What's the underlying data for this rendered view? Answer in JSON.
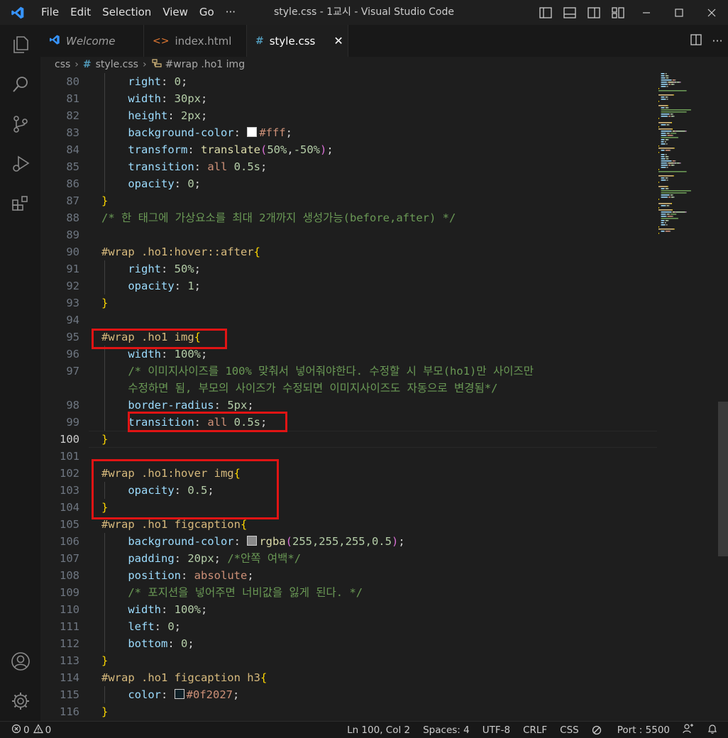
{
  "window": {
    "title": "style.css - 1교시 - Visual Studio Code",
    "menu": [
      "File",
      "Edit",
      "Selection",
      "View",
      "Go",
      "···"
    ]
  },
  "tabs": [
    {
      "label": "Welcome",
      "icon": "vscode-logo-icon",
      "icon_color": "#3794ff"
    },
    {
      "label": "index.html",
      "icon": "html-icon",
      "icon_color": "#e37933"
    },
    {
      "label": "style.css",
      "icon": "css-hash-icon",
      "icon_color": "#519aba",
      "active": true
    }
  ],
  "breadcrumb": {
    "folder": "css",
    "file": "style.css",
    "symbol": "#wrap .ho1 img"
  },
  "editor": {
    "current_line": 100,
    "lines": [
      {
        "n": "80",
        "tokens": [
          [
            "    ",
            "txt"
          ],
          [
            "right",
            "prop"
          ],
          [
            ": ",
            "txt"
          ],
          [
            "0",
            "num"
          ],
          [
            ";",
            "txt"
          ]
        ]
      },
      {
        "n": "81",
        "tokens": [
          [
            "    ",
            "txt"
          ],
          [
            "width",
            "prop"
          ],
          [
            ": ",
            "txt"
          ],
          [
            "30px",
            "num"
          ],
          [
            ";",
            "txt"
          ]
        ]
      },
      {
        "n": "82",
        "tokens": [
          [
            "    ",
            "txt"
          ],
          [
            "height",
            "prop"
          ],
          [
            ": ",
            "txt"
          ],
          [
            "2px",
            "num"
          ],
          [
            ";",
            "txt"
          ]
        ]
      },
      {
        "n": "83",
        "tokens": [
          [
            "    ",
            "txt"
          ],
          [
            "background-color",
            "prop"
          ],
          [
            ": ",
            "txt"
          ],
          [
            "#ffffff",
            "swatch"
          ],
          [
            "#fff",
            "kw"
          ],
          [
            ";",
            "txt"
          ]
        ]
      },
      {
        "n": "84",
        "tokens": [
          [
            "    ",
            "txt"
          ],
          [
            "transform",
            "prop"
          ],
          [
            ": ",
            "txt"
          ],
          [
            "translate",
            "fn"
          ],
          [
            "(",
            "br2"
          ],
          [
            "50%",
            "num"
          ],
          [
            ",",
            "txt"
          ],
          [
            "-50%",
            "num"
          ],
          [
            ")",
            "br2"
          ],
          [
            ";",
            "txt"
          ]
        ]
      },
      {
        "n": "85",
        "tokens": [
          [
            "    ",
            "txt"
          ],
          [
            "transition",
            "prop"
          ],
          [
            ": ",
            "txt"
          ],
          [
            "all ",
            "kw"
          ],
          [
            "0.5s",
            "num"
          ],
          [
            ";",
            "txt"
          ]
        ]
      },
      {
        "n": "86",
        "tokens": [
          [
            "    ",
            "txt"
          ],
          [
            "opacity",
            "prop"
          ],
          [
            ": ",
            "txt"
          ],
          [
            "0",
            "num"
          ],
          [
            ";",
            "txt"
          ]
        ]
      },
      {
        "n": "87",
        "tokens": [
          [
            "}",
            "br1"
          ]
        ]
      },
      {
        "n": "88",
        "tokens": [
          [
            "/* 한 태그에 가상요소를 최대 2개까지 생성가능(before,after) */",
            "cm"
          ]
        ]
      },
      {
        "n": "89",
        "tokens": []
      },
      {
        "n": "90",
        "tokens": [
          [
            "#wrap .ho1:hover::after",
            "sel"
          ],
          [
            "{",
            "br1"
          ]
        ]
      },
      {
        "n": "91",
        "tokens": [
          [
            "    ",
            "txt"
          ],
          [
            "right",
            "prop"
          ],
          [
            ": ",
            "txt"
          ],
          [
            "50%",
            "num"
          ],
          [
            ";",
            "txt"
          ]
        ]
      },
      {
        "n": "92",
        "tokens": [
          [
            "    ",
            "txt"
          ],
          [
            "opacity",
            "prop"
          ],
          [
            ": ",
            "txt"
          ],
          [
            "1",
            "num"
          ],
          [
            ";",
            "txt"
          ]
        ]
      },
      {
        "n": "93",
        "tokens": [
          [
            "}",
            "br1"
          ]
        ]
      },
      {
        "n": "94",
        "tokens": []
      },
      {
        "n": "95",
        "tokens": [
          [
            "#wrap .ho1 img",
            "sel"
          ],
          [
            "{",
            "br1"
          ]
        ]
      },
      {
        "n": "96",
        "tokens": [
          [
            "    ",
            "txt"
          ],
          [
            "width",
            "prop"
          ],
          [
            ": ",
            "txt"
          ],
          [
            "100%",
            "num"
          ],
          [
            ";",
            "txt"
          ]
        ]
      },
      {
        "n": "97",
        "tokens": [
          [
            "    ",
            "txt"
          ],
          [
            "/* 이미지사이즈를 100% 맞춰서 넣어줘야한다. 수정할 시 부모(ho1)만 사이즈만",
            "cm"
          ]
        ]
      },
      {
        "n": "",
        "tokens": [
          [
            "    ",
            "txt"
          ],
          [
            "수정하면 됨, 부모의 사이즈가 수정되면 이미지사이즈도 자동으로 변경됨*/",
            "cm"
          ]
        ]
      },
      {
        "n": "98",
        "tokens": [
          [
            "    ",
            "txt"
          ],
          [
            "border-radius",
            "prop"
          ],
          [
            ": ",
            "txt"
          ],
          [
            "5px",
            "num"
          ],
          [
            ";",
            "txt"
          ]
        ]
      },
      {
        "n": "99",
        "tokens": [
          [
            "    ",
            "txt"
          ],
          [
            "transition",
            "prop"
          ],
          [
            ": ",
            "txt"
          ],
          [
            "all ",
            "kw"
          ],
          [
            "0.5s",
            "num"
          ],
          [
            ";",
            "txt"
          ]
        ]
      },
      {
        "n": "100",
        "tokens": [
          [
            "}",
            "br1"
          ]
        ]
      },
      {
        "n": "101",
        "tokens": []
      },
      {
        "n": "102",
        "tokens": [
          [
            "#wrap .ho1:hover img",
            "sel"
          ],
          [
            "{",
            "br1"
          ]
        ]
      },
      {
        "n": "103",
        "tokens": [
          [
            "    ",
            "txt"
          ],
          [
            "opacity",
            "prop"
          ],
          [
            ": ",
            "txt"
          ],
          [
            "0.5",
            "num"
          ],
          [
            ";",
            "txt"
          ]
        ]
      },
      {
        "n": "104",
        "tokens": [
          [
            "}",
            "br1"
          ]
        ]
      },
      {
        "n": "105",
        "tokens": [
          [
            "#wrap .ho1 figcaption",
            "sel"
          ],
          [
            "{",
            "br1"
          ]
        ]
      },
      {
        "n": "106",
        "tokens": [
          [
            "    ",
            "txt"
          ],
          [
            "background-color",
            "prop"
          ],
          [
            ": ",
            "txt"
          ],
          [
            "#8a8a8a",
            "swatch"
          ],
          [
            "rgba",
            "fn"
          ],
          [
            "(",
            "br2"
          ],
          [
            "255,255,255,0.5",
            "num"
          ],
          [
            ")",
            "br2"
          ],
          [
            ";",
            "txt"
          ]
        ]
      },
      {
        "n": "107",
        "tokens": [
          [
            "    ",
            "txt"
          ],
          [
            "padding",
            "prop"
          ],
          [
            ": ",
            "txt"
          ],
          [
            "20px",
            "num"
          ],
          [
            "; ",
            "txt"
          ],
          [
            "/*안쪽 여백*/",
            "cm"
          ]
        ]
      },
      {
        "n": "108",
        "tokens": [
          [
            "    ",
            "txt"
          ],
          [
            "position",
            "prop"
          ],
          [
            ": ",
            "txt"
          ],
          [
            "absolute",
            "kw"
          ],
          [
            ";",
            "txt"
          ]
        ]
      },
      {
        "n": "109",
        "tokens": [
          [
            "    ",
            "txt"
          ],
          [
            "/* 포지션을 넣어주면 너비값을 잃게 된다. */",
            "cm"
          ]
        ]
      },
      {
        "n": "110",
        "tokens": [
          [
            "    ",
            "txt"
          ],
          [
            "width",
            "prop"
          ],
          [
            ": ",
            "txt"
          ],
          [
            "100%",
            "num"
          ],
          [
            ";",
            "txt"
          ]
        ]
      },
      {
        "n": "111",
        "tokens": [
          [
            "    ",
            "txt"
          ],
          [
            "left",
            "prop"
          ],
          [
            ": ",
            "txt"
          ],
          [
            "0",
            "num"
          ],
          [
            ";",
            "txt"
          ]
        ]
      },
      {
        "n": "112",
        "tokens": [
          [
            "    ",
            "txt"
          ],
          [
            "bottom",
            "prop"
          ],
          [
            ": ",
            "txt"
          ],
          [
            "0",
            "num"
          ],
          [
            ";",
            "txt"
          ]
        ]
      },
      {
        "n": "113",
        "tokens": [
          [
            "}",
            "br1"
          ]
        ]
      },
      {
        "n": "114",
        "tokens": [
          [
            "#wrap .ho1 figcaption h3",
            "sel"
          ],
          [
            "{",
            "br1"
          ]
        ]
      },
      {
        "n": "115",
        "tokens": [
          [
            "    ",
            "txt"
          ],
          [
            "color",
            "prop"
          ],
          [
            ": ",
            "txt"
          ],
          [
            "#0f2027",
            "swatch"
          ],
          [
            "#0f2027",
            "kw"
          ],
          [
            ";",
            "txt"
          ]
        ]
      },
      {
        "n": "116",
        "tokens": [
          [
            "}",
            "br1"
          ]
        ]
      }
    ],
    "highlight_color": "#e11414"
  },
  "statusbar": {
    "errors": "0",
    "warnings": "0",
    "position": "Ln 100, Col 2",
    "spaces": "Spaces: 4",
    "encoding": "UTF-8",
    "eol": "CRLF",
    "language": "CSS",
    "port": "Port : 5500"
  }
}
